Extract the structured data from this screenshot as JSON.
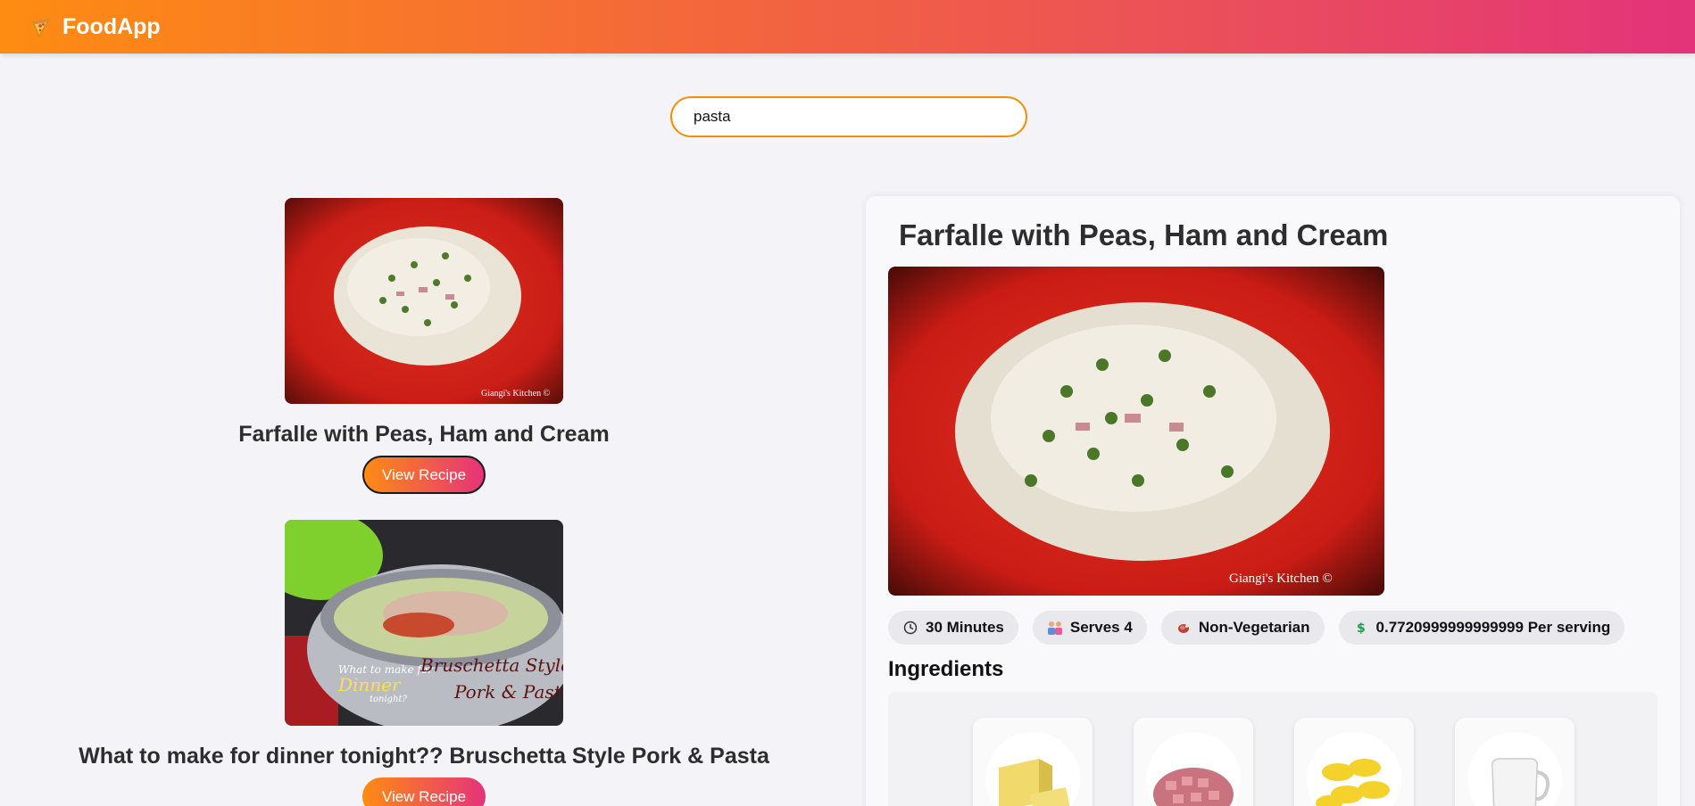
{
  "app": {
    "name": "FoodApp",
    "logo_icon": "pizza-icon"
  },
  "search": {
    "value": "pasta"
  },
  "results": [
    {
      "title": "Farfalle with Peas, Ham and Cream",
      "button": "View Recipe",
      "image_caption": "Giangi's Kitchen ©"
    },
    {
      "title": "What to make for dinner tonight?? Bruschetta Style Pork & Pasta",
      "button": "View Recipe",
      "image_text": {
        "line1": "What to make for",
        "line2": "Dinner",
        "line3": "tonight?",
        "title1": "Bruschetta Style",
        "title2": "Pork & Pasta"
      }
    }
  ],
  "detail": {
    "title": "Farfalle with Peas, Ham and Cream",
    "image_caption": "Giangi's Kitchen ©",
    "chips": {
      "time": "30 Minutes",
      "serves": "Serves 4",
      "diet": "Non-Vegetarian",
      "price": "0.7720999999999999 Per serving"
    },
    "ingredients_heading": "Ingredients",
    "ingredients": [
      "butter",
      "ham",
      "farfalle",
      "cream"
    ]
  },
  "colors": {
    "accent_start": "#fe8c12",
    "accent_end": "#e3337a",
    "search_border": "#fb8c00"
  }
}
